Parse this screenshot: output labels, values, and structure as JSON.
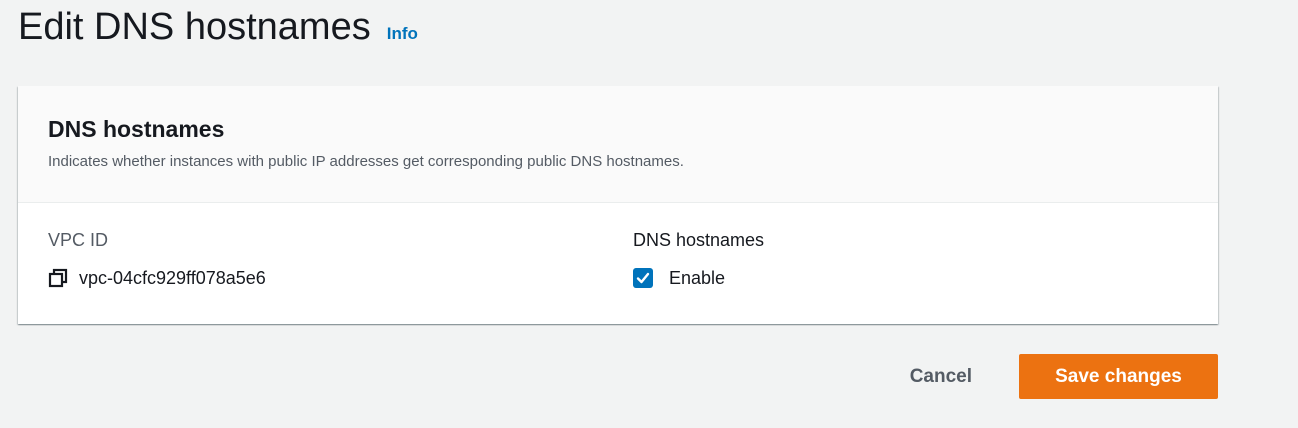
{
  "header": {
    "title": "Edit DNS hostnames",
    "info_label": "Info"
  },
  "panel": {
    "title": "DNS hostnames",
    "description": "Indicates whether instances with public IP addresses get corresponding public DNS hostnames.",
    "vpc": {
      "label": "VPC ID",
      "value": "vpc-04cfc929ff078a5e6",
      "icon": "copy-icon"
    },
    "dns": {
      "label": "DNS hostnames",
      "checkbox_label": "Enable",
      "checked": true
    }
  },
  "actions": {
    "cancel_label": "Cancel",
    "save_label": "Save changes"
  },
  "colors": {
    "background": "#f2f3f3",
    "accent_link": "#0073bb",
    "primary_button": "#ec7211",
    "checkbox": "#0073bb"
  }
}
